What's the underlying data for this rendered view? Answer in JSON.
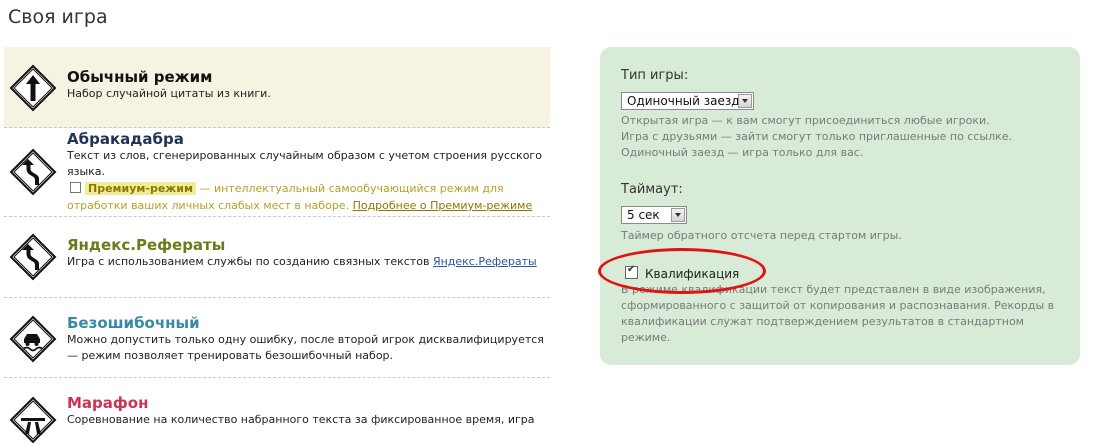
{
  "page": {
    "title": "Своя игра"
  },
  "modes": [
    {
      "title": "Обычный режим",
      "desc": "Набор случайной цитаты из книги."
    },
    {
      "title": "Абракадабра",
      "desc": "Текст из слов, сгенерированных случайным образом с учетом строения русского языка.",
      "premium": {
        "badge": "Премиум-режим",
        "text": " — интеллектуальный самообучающийся режим для отработки ваших личных слабых мест в наборе. ",
        "link": "Подробнее о Премиум-режиме"
      }
    },
    {
      "title": "Яндекс.Рефераты",
      "desc": "Игра с использованием службы по созданию связных текстов ",
      "link": "Яндекс.Рефераты"
    },
    {
      "title": "Безошибочный",
      "desc": "Можно допустить только одну ошибку, после второй игрок дисквалифицируется — режим позволяет тренировать безошибочный набор."
    },
    {
      "title": "Марафон",
      "desc": "Соревнование на количество набранного текста за фиксированное время, игра"
    }
  ],
  "settings": {
    "game_type": {
      "label": "Тип игры:",
      "value": "Одиночный заезд",
      "help": [
        "Открытая игра — к вам смогут присоединиться любые игроки.",
        "Игра с друзьями — зайти смогут только приглашенные по ссылке.",
        "Одиночный заезд — игра только для вас."
      ]
    },
    "timeout": {
      "label": "Таймаут:",
      "value": "5 сек",
      "help": "Таймер обратного отсчета перед стартом игры."
    },
    "qualification": {
      "label": "Квалификация",
      "checked": true,
      "help": "В режиме квалификации текст будет представлен в виде изображения, сформированного с защитой от копирования и распознавания. Рекорды в квалификации служат подтверждением результатов в стандартном режиме."
    }
  },
  "colors": {
    "panel_bg": "#d7ebd7",
    "selected_bg": "#f7f3e3",
    "highlight_ring": "#e01212"
  }
}
